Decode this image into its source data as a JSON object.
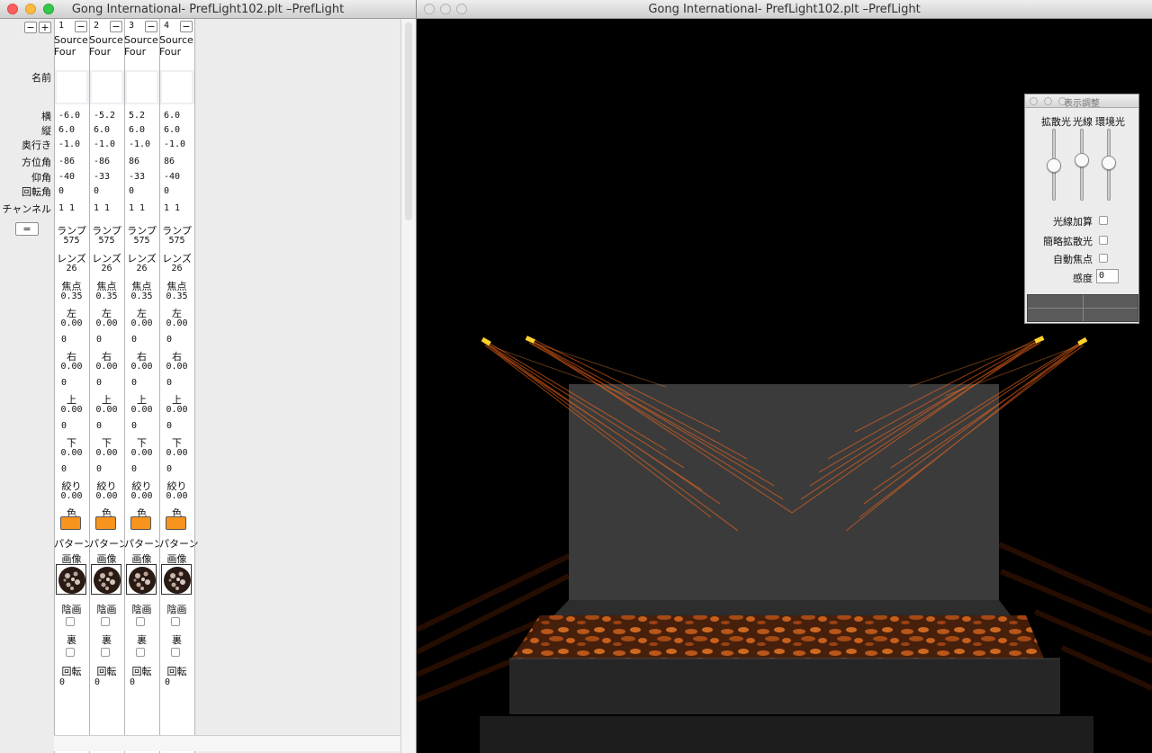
{
  "left_window": {
    "title": "Gong International- PrefLight102.plt –PrefLight"
  },
  "right_window": {
    "title": "Gong International- PrefLight102.plt –PrefLight"
  },
  "toolbar": {
    "minus": "−",
    "plus": "+",
    "equals": "="
  },
  "row_labels": {
    "name": "名前",
    "x": "横",
    "y": "縦",
    "z": "奥行き",
    "azimuth": "方位角",
    "elevation": "仰角",
    "rotation": "回転角",
    "channel": "チャンネル"
  },
  "param_labels": {
    "lamp": "ランプ",
    "lens": "レンズ",
    "focus": "焦点",
    "left": "左",
    "right": "右",
    "top": "上",
    "bottom": "下",
    "iris": "絞り",
    "color": "色",
    "pattern": "パターン",
    "image": "画像",
    "negative": "陰画",
    "reverse": "裏",
    "rotate": "回転"
  },
  "fixtures": [
    {
      "num": "1",
      "type": "Source Four",
      "name": "",
      "x": "-6.0",
      "y": "6.0",
      "z": "-1.0",
      "azimuth": "-86",
      "elevation": "-40",
      "rotation": "0",
      "channel": "1  1",
      "lamp": "575",
      "lens": "26",
      "focus": "0.35",
      "left": "0.00",
      "left2": "0",
      "right": "0.00",
      "right2": "0",
      "top": "0.00",
      "top2": "0",
      "bottom": "0.00",
      "bottom2": "0",
      "iris": "0.00",
      "rotate": "0"
    },
    {
      "num": "2",
      "type": "Source Four",
      "name": "",
      "x": "-5.2",
      "y": "6.0",
      "z": "-1.0",
      "azimuth": "-86",
      "elevation": "-33",
      "rotation": "0",
      "channel": "1  1",
      "lamp": "575",
      "lens": "26",
      "focus": "0.35",
      "left": "0.00",
      "left2": "0",
      "right": "0.00",
      "right2": "0",
      "top": "0.00",
      "top2": "0",
      "bottom": "0.00",
      "bottom2": "0",
      "iris": "0.00",
      "rotate": "0"
    },
    {
      "num": "3",
      "type": "Source Four",
      "name": "",
      "x": "5.2",
      "y": "6.0",
      "z": "-1.0",
      "azimuth": "86",
      "elevation": "-33",
      "rotation": "0",
      "channel": "1  1",
      "lamp": "575",
      "lens": "26",
      "focus": "0.35",
      "left": "0.00",
      "left2": "0",
      "right": "0.00",
      "right2": "0",
      "top": "0.00",
      "top2": "0",
      "bottom": "0.00",
      "bottom2": "0",
      "iris": "0.00",
      "rotate": "0"
    },
    {
      "num": "4",
      "type": "Source Four",
      "name": "",
      "x": "6.0",
      "y": "6.0",
      "z": "-1.0",
      "azimuth": "86",
      "elevation": "-40",
      "rotation": "0",
      "channel": "1  1",
      "lamp": "575",
      "lens": "26",
      "focus": "0.35",
      "left": "0.00",
      "left2": "0",
      "right": "0.00",
      "right2": "0",
      "top": "0.00",
      "top2": "0",
      "bottom": "0.00",
      "bottom2": "0",
      "iris": "0.00",
      "rotate": "0"
    }
  ],
  "fixture_color": "#f7941d",
  "display_panel": {
    "title": "表示調整",
    "slider_labels": [
      "拡散光",
      "光線",
      "環境光"
    ],
    "slider_levels": [
      0.5,
      0.6,
      0.55
    ],
    "opt_beam_add": "光線加算",
    "opt_simple_diffuse": "簡略拡散光",
    "opt_auto_focus": "自動焦点",
    "sensitivity_label": "感度",
    "sensitivity_value": "0"
  }
}
